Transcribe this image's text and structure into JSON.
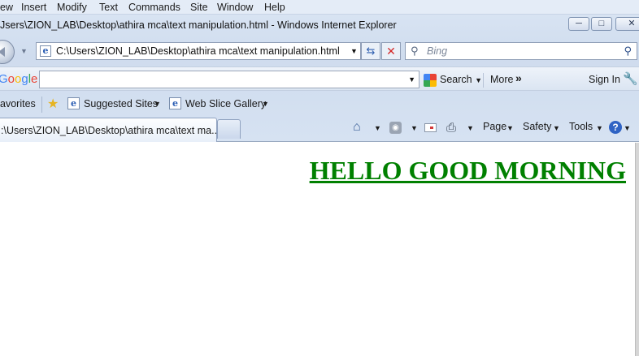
{
  "menu": [
    "ew",
    "Insert",
    "Modify",
    "Text",
    "Commands",
    "Site",
    "Window",
    "Help"
  ],
  "window": {
    "title": "Jsers\\ZION_LAB\\Desktop\\athira mca\\text manipulation.html - Windows Internet Explorer",
    "min_glyph": "─",
    "max_glyph": "□",
    "close_glyph": "✕"
  },
  "address": {
    "url": "C:\\Users\\ZION_LAB\\Desktop\\athira mca\\text manipulation.html",
    "dropdown_glyph": "▼",
    "refresh_glyph": "⇆",
    "stop_glyph": "✕"
  },
  "search_box": {
    "placeholder": "Bing",
    "search_glyph": "⚲"
  },
  "google_toolbar": {
    "logo_letters": [
      "G",
      "o",
      "o",
      "g",
      "l",
      "e"
    ],
    "logo_colors": [
      "#4285f4",
      "#ea4335",
      "#fbbc05",
      "#4285f4",
      "#34a853",
      "#ea4335"
    ],
    "search_label": "Search",
    "more_label": "More",
    "more_glyph": "»",
    "signin_label": "Sign In",
    "wrench_glyph": "🔧",
    "drop_glyph": "▼"
  },
  "favorites": {
    "label": "avorites",
    "links": [
      "Suggested Sites",
      "Web Slice Gallery"
    ],
    "drop_glyph": "▼"
  },
  "tabs": {
    "active_label": ":\\Users\\ZION_LAB\\Desktop\\athira mca\\text ma..."
  },
  "command_bar": {
    "page_label": "Page",
    "safety_label": "Safety",
    "tools_label": "Tools",
    "help_glyph": "?",
    "drop_glyph": "▼",
    "home_glyph": "⌂",
    "rss_glyph": "◉",
    "print_glyph": "⎙"
  },
  "page": {
    "heading": "HELLO GOOD MORNING",
    "heading_color": "#008000"
  },
  "icons": [
    "back-icon",
    "ie-page-icon",
    "refresh-icon",
    "stop-icon",
    "search-icon",
    "google-search-icon",
    "wrench-icon",
    "favorites-star-icon",
    "home-icon",
    "rss-icon",
    "mail-icon",
    "print-icon",
    "help-icon"
  ]
}
